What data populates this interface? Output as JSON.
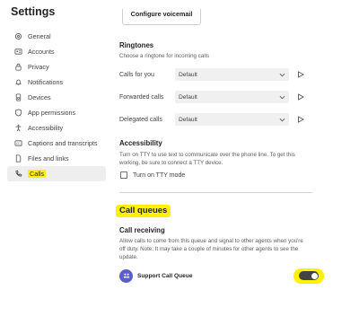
{
  "app": {
    "title": "Settings"
  },
  "sidebar": {
    "items": [
      {
        "label": "General",
        "icon": "gear-icon"
      },
      {
        "label": "Accounts",
        "icon": "accounts-icon"
      },
      {
        "label": "Privacy",
        "icon": "lock-icon"
      },
      {
        "label": "Notifications",
        "icon": "bell-icon"
      },
      {
        "label": "Devices",
        "icon": "devices-icon"
      },
      {
        "label": "App permissions",
        "icon": "shield-icon"
      },
      {
        "label": "Accessibility",
        "icon": "accessibility-icon"
      },
      {
        "label": "Captions and transcripts",
        "icon": "captions-icon"
      },
      {
        "label": "Files and links",
        "icon": "file-icon"
      },
      {
        "label": "Calls",
        "icon": "phone-icon",
        "active": true
      }
    ]
  },
  "voicemail": {
    "button_label": "Configure voicemail"
  },
  "ringtones": {
    "heading": "Ringtones",
    "note": "Choose a ringtone for incoming calls",
    "rows": [
      {
        "label": "Calls for you",
        "value": "Default"
      },
      {
        "label": "Forwarded calls",
        "value": "Default"
      },
      {
        "label": "Delegated calls",
        "value": "Default"
      }
    ]
  },
  "accessibility": {
    "heading": "Accessibility",
    "note_line1": "Turn on TTY to use text to communicate over the phone line. To get this",
    "note_line2": "working, be sure to connect a TTY device.",
    "tty_label": "Turn on TTY mode",
    "tty_checked": false
  },
  "call_queues": {
    "title": "Call queues",
    "receiving_heading": "Call receiving",
    "note_line1": "Allow calls to come from this queue and signal to other agents when you're",
    "note_line2": "off duty. Note: It may take a couple of minutes for other agents to see the",
    "note_line3": "update.",
    "queue_name": "Support Call Queue",
    "queue_enabled": true
  },
  "colors": {
    "highlight": "#fff200",
    "accent": "#5b5fc7",
    "toggle_on": "#424242"
  }
}
